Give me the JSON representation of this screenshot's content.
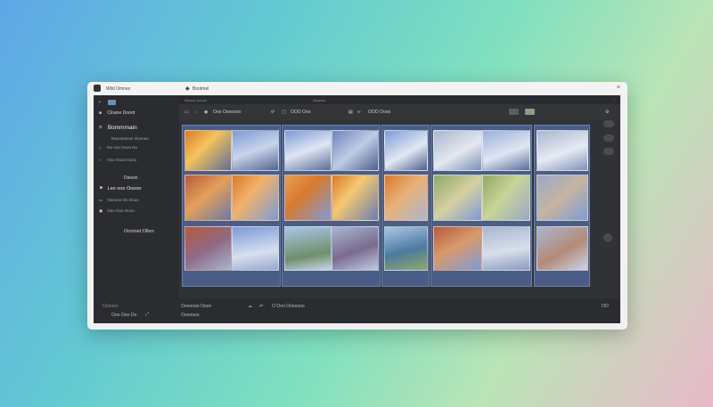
{
  "window": {
    "title": "Wild Omnex",
    "tab_title": "Bootmel",
    "close_glyph": "×"
  },
  "sidebar": {
    "top_label": "Cloane Doord",
    "sections": [
      {
        "heading": "Bommmain",
        "items": [
          "Naooreeson Oooooo",
          "No ooo Oooo No",
          "Ooo Oooo Oooo"
        ]
      },
      {
        "heading": "Dieson",
        "items": [
          "Lee ooo Ooooo",
          "Oooooo Oo Oooo",
          "Ooo Ooo Oooo"
        ]
      }
    ],
    "footer_label": "Ooninet Ollen"
  },
  "toolbar_top": {
    "left_text": "Ooooo  Ooooo",
    "center_text": "Oooooo"
  },
  "toolbar": {
    "group1": "Ooo Ooooooo",
    "group2": "OOO Ooo",
    "group3": "OOO Oooo"
  },
  "grid": {
    "colors": {
      "fire": "#d9792c",
      "sky": "#7d9bd6",
      "plant": "#8fa86a",
      "autumn": "#b65a3c",
      "haze": "#a9b6cf"
    }
  },
  "bottombar": {
    "left_top": "Oooooo",
    "left_bottom": "Ooo Ooo Oo",
    "mid_top": "Ooooooo Oooo",
    "mid_bottom": "Ooooooo",
    "center": "O Ooo Ooooooo",
    "right": "OO"
  }
}
